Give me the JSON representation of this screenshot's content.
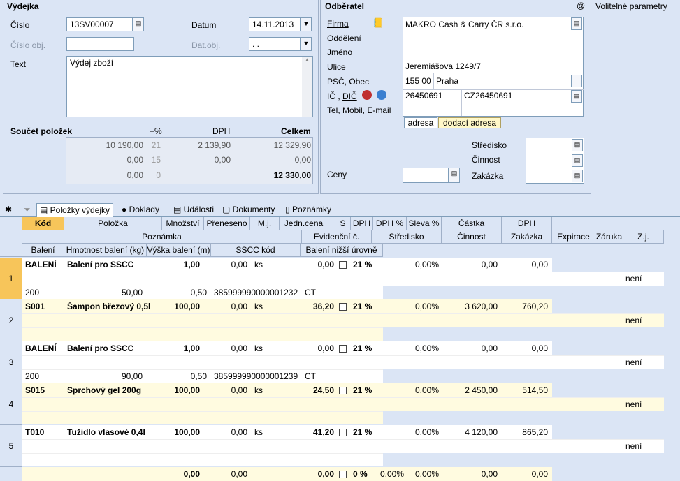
{
  "vydejka": {
    "title": "Výdejka",
    "cislo_label": "Číslo",
    "cislo": "13SV00007",
    "datum_label": "Datum",
    "datum": "14.11.2013",
    "cislo_obj_label": "Číslo obj.",
    "dat_obj_label": "Dat.obj.",
    "dat_obj": " .  .",
    "text_label": "Text",
    "text": "Výdej zboží"
  },
  "summary": {
    "title": "Součet položek",
    "plus_label": "+%",
    "dph_label": "DPH",
    "celkem_label": "Celkem",
    "rows": [
      {
        "base": "10 190,00",
        "pct": "21",
        "dph": "2 139,90",
        "total": "12 329,90"
      },
      {
        "base": "0,00",
        "pct": "15",
        "dph": "0,00",
        "total": "0,00"
      },
      {
        "base": "0,00",
        "pct": "0",
        "dph": "",
        "total": "12 330,00"
      }
    ]
  },
  "odberatel": {
    "title": "Odběratel",
    "at": "@",
    "volitelne": "Volitelné parametry",
    "firma_label": "Firma",
    "firma": "MAKRO Cash & Carry ČR s.r.o.",
    "oddeleni_label": "Oddělení",
    "jmeno_label": "Jméno",
    "ulice_label": "Ulice",
    "ulice": "Jeremiášova 1249/7",
    "psc_label": "PSČ, Obec",
    "psc": "155 00",
    "obec": "Praha",
    "ic_label": "IČ",
    "dic_label": "DIČ",
    "ic": "26450691",
    "dic": "CZ26450691",
    "tel_label": "Tel, Mobil,",
    "email_label": "E-mail",
    "tab_adresa": "adresa",
    "tab_dodaci": "dodací adresa",
    "stredisko_label": "Středisko",
    "cinnost_label": "Činnost",
    "zakazka_label": "Zakázka",
    "ceny_label": "Ceny"
  },
  "tabs": [
    "Položky výdejky",
    "Doklady",
    "Události",
    "Dokumenty",
    "Poznámky"
  ],
  "headers": {
    "r1": [
      "Kód",
      "Položka",
      "Množství",
      "Přeneseno",
      "M.j.",
      "Jedn.cena",
      "S",
      "DPH",
      "DPH %",
      "Sleva %",
      "Částka",
      "DPH"
    ],
    "r2": [
      "Poznámka",
      "Evidenční č.",
      "Středisko",
      "Činnost",
      "Zakázka",
      "Expirace",
      "Záruka",
      "Z.j."
    ],
    "r3": [
      "Balení",
      "Hmotnost balení (kg)",
      "Výška balení (m)",
      "SSCC kód",
      "Balení nižší úrovně"
    ]
  },
  "rows": [
    {
      "num": "1",
      "kod": "BALENÍ",
      "polozka": "Balení pro SSCC",
      "mnozstvi": "1,00",
      "preneseno": "0,00",
      "mj": "ks",
      "cena": "0,00",
      "dph": "21 %",
      "sleva": "0,00%",
      "castka": "0,00",
      "dphv": "0,00",
      "zj": "není",
      "baleni": "200",
      "hmotnost": "50,00",
      "vyska": "0,50",
      "sscc": "385999990000001232",
      "nizsi": "CT"
    },
    {
      "num": "2",
      "kod": "S001",
      "polozka": "Šampon březový 0,5l",
      "mnozstvi": "100,00",
      "preneseno": "0,00",
      "mj": "ks",
      "cena": "36,20",
      "dph": "21 %",
      "sleva": "0,00%",
      "castka": "3 620,00",
      "dphv": "760,20",
      "zj": "není"
    },
    {
      "num": "3",
      "kod": "BALENÍ",
      "polozka": "Balení pro SSCC",
      "mnozstvi": "1,00",
      "preneseno": "0,00",
      "mj": "ks",
      "cena": "0,00",
      "dph": "21 %",
      "sleva": "0,00%",
      "castka": "0,00",
      "dphv": "0,00",
      "zj": "není",
      "baleni": "200",
      "hmotnost": "90,00",
      "vyska": "0,50",
      "sscc": "385999990000001239",
      "nizsi": "CT"
    },
    {
      "num": "4",
      "kod": "S015",
      "polozka": "Sprchový gel 200g",
      "mnozstvi": "100,00",
      "preneseno": "0,00",
      "mj": "ks",
      "cena": "24,50",
      "dph": "21 %",
      "sleva": "0,00%",
      "castka": "2 450,00",
      "dphv": "514,50",
      "zj": "není"
    },
    {
      "num": "5",
      "kod": "T010",
      "polozka": "Tužidlo vlasové 0,4l",
      "mnozstvi": "100,00",
      "preneseno": "0,00",
      "mj": "ks",
      "cena": "41,20",
      "dph": "21 %",
      "sleva": "0,00%",
      "castka": "4 120,00",
      "dphv": "865,20",
      "zj": "není"
    }
  ],
  "lastrow": {
    "mnozstvi": "0,00",
    "preneseno": "0,00",
    "cena": "0,00",
    "dph": "0 %",
    "dphpct": "0,00%",
    "sleva": "0,00%",
    "castka": "0,00",
    "dphv": "0,00"
  }
}
